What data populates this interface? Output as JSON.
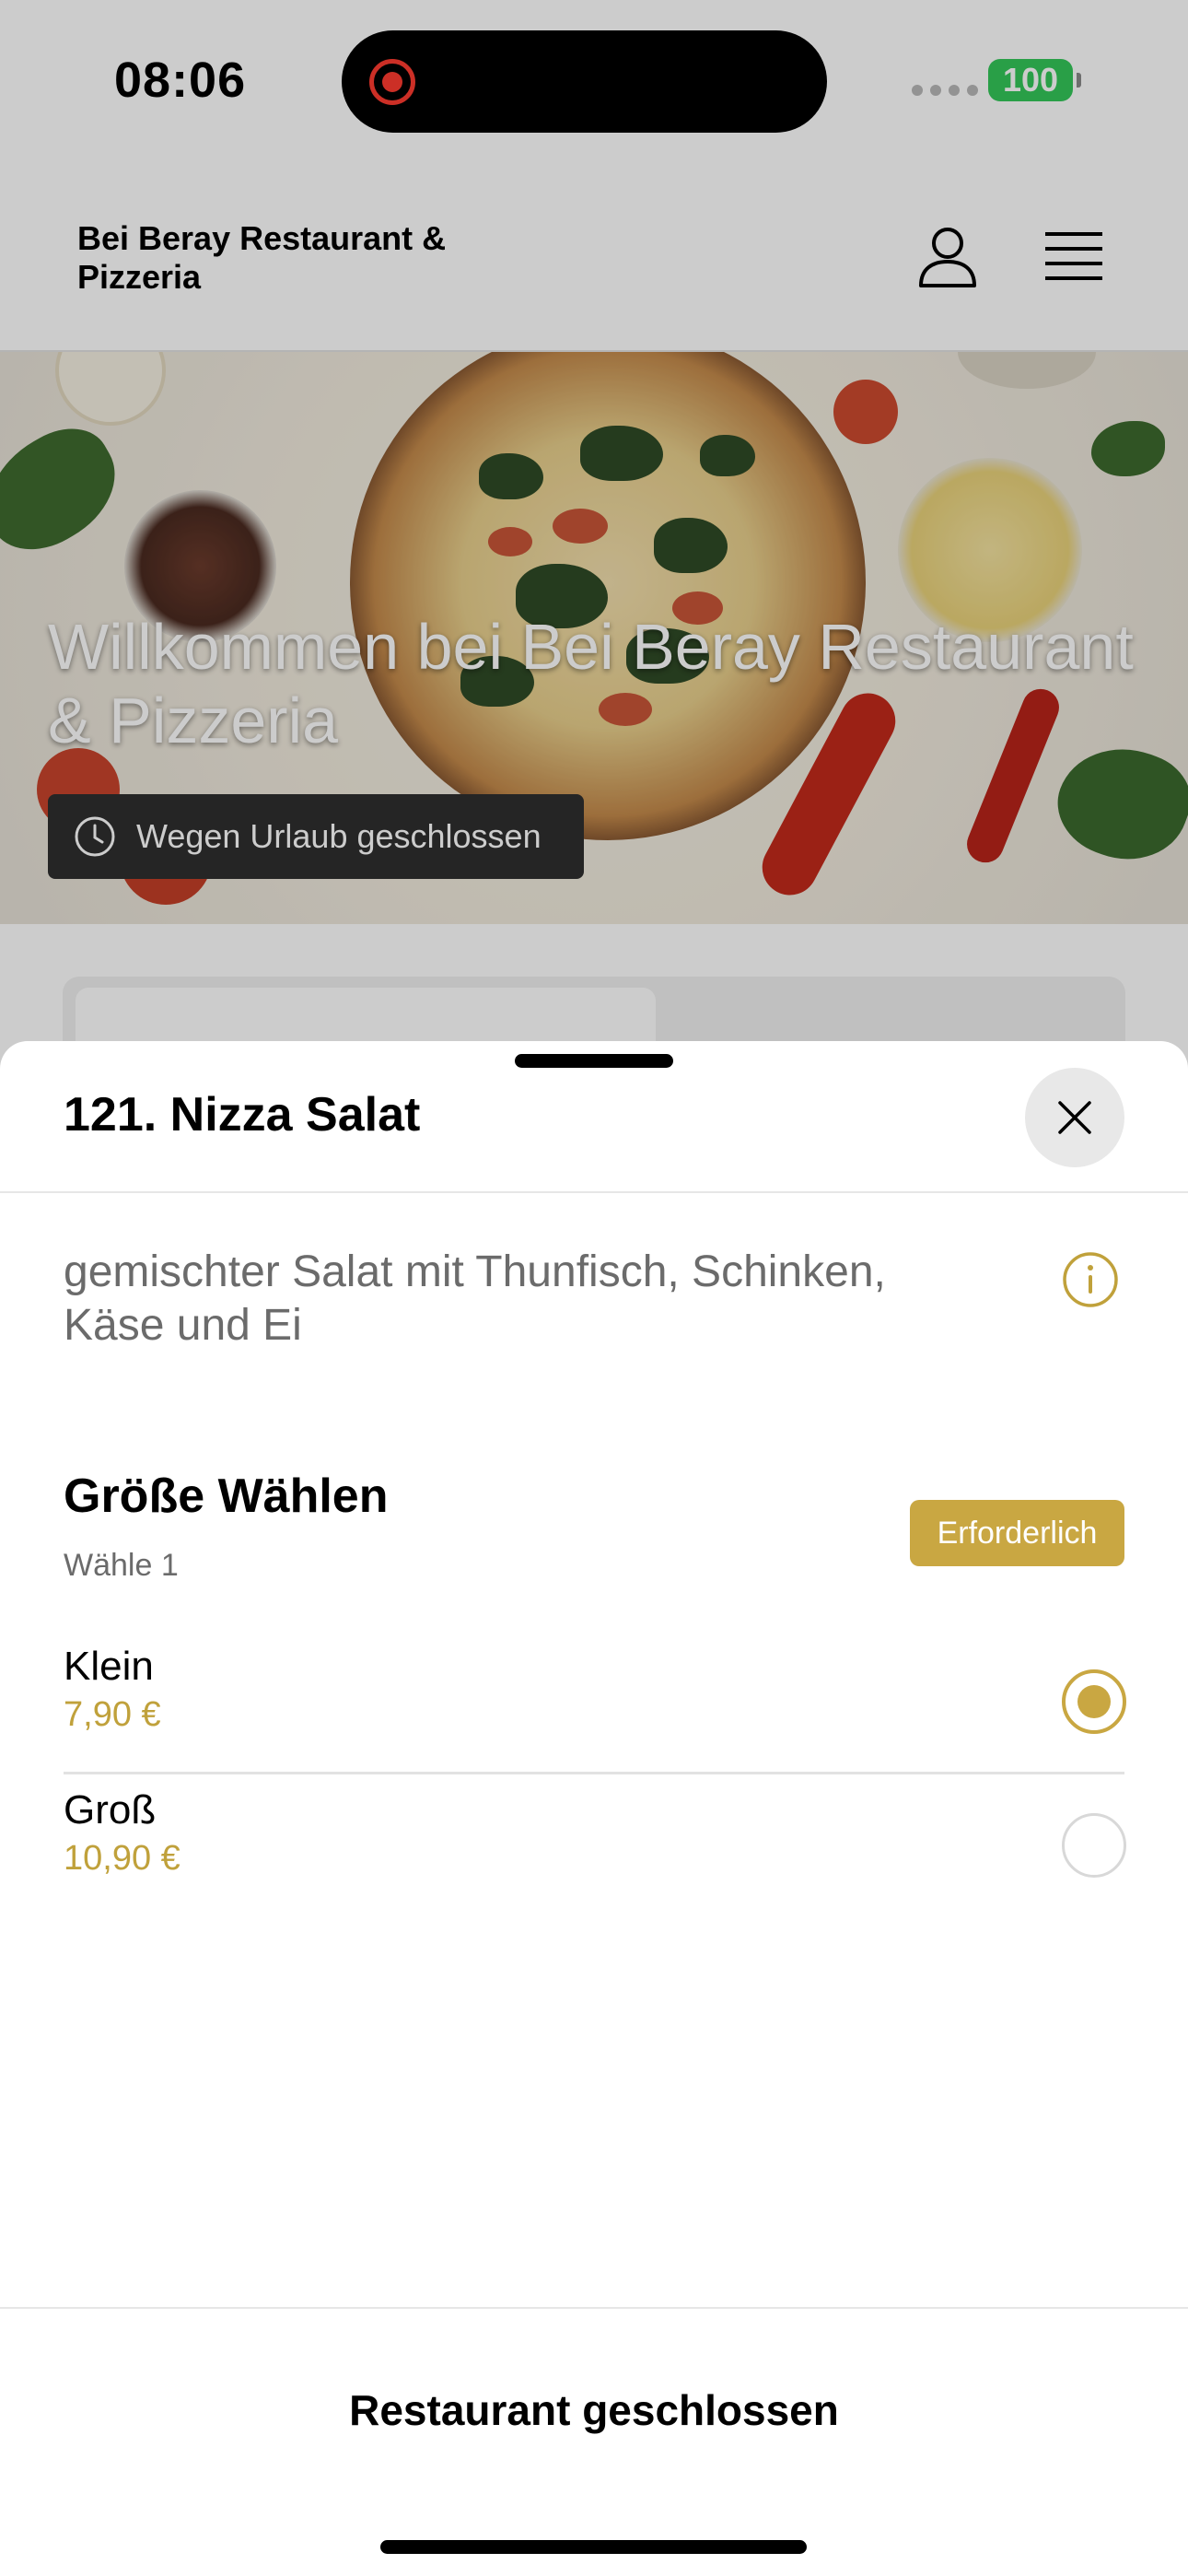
{
  "status_bar": {
    "time": "08:06",
    "battery": "100"
  },
  "header": {
    "brand": "Bei Beray Restaurant & Pizzeria",
    "user_icon": "user-icon",
    "menu_icon": "hamburger-menu-icon"
  },
  "hero": {
    "title": "Willkommen bei Bei Beray Restaurant & Pizzeria",
    "closed_label": "Wegen Urlaub geschlossen",
    "closed_icon": "clock-icon"
  },
  "colors": {
    "accent": "#c9a742",
    "price": "#c0a13b",
    "battery": "#34c759"
  },
  "sheet": {
    "title": "121. Nizza Salat",
    "close_icon": "close-icon",
    "description": "gemischter Salat mit Thunfisch, Schinken, Käse und Ei",
    "info_icon": "info-icon",
    "option_group": {
      "title": "Größe Wählen",
      "subtitle": "Wähle 1",
      "badge": "Erforderlich",
      "options": [
        {
          "label": "Klein",
          "price": "7,90 €",
          "selected": true
        },
        {
          "label": "Groß",
          "price": "10,90 €",
          "selected": false
        }
      ]
    },
    "footer_button": "Restaurant geschlossen"
  }
}
